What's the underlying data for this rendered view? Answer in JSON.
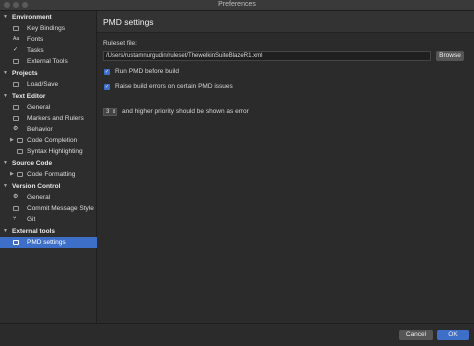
{
  "window": {
    "title": "Preferences"
  },
  "sidebar": {
    "sections": [
      {
        "label": "Environment",
        "items": [
          "Key Bindings",
          "Fonts",
          "Tasks",
          "External Tools"
        ]
      },
      {
        "label": "Projects",
        "items": [
          "Load/Save"
        ]
      },
      {
        "label": "Text Editor",
        "items": [
          "General",
          "Markers and Rulers",
          "Behavior",
          "Code Completion",
          "Syntax Highlighting"
        ]
      },
      {
        "label": "Source Code",
        "items": [
          "Code Formatting"
        ]
      },
      {
        "label": "Version Control",
        "items": [
          "General",
          "Commit Message Style",
          "Git"
        ]
      },
      {
        "label": "External tools",
        "items": [
          "PMD settings"
        ]
      }
    ]
  },
  "main": {
    "title": "PMD settings",
    "ruleset_label": "Ruleset file:",
    "ruleset_value": "/Users/rustamnurgudin/ruleset/ThewelkinSuiteBlazeR1.xml",
    "browse_label": "Browse",
    "run_pmd_label": "Run PMD before build",
    "raise_errors_label": "Raise build errors on certain PMD issues",
    "priority_value": "3",
    "priority_label": "and higher priority should be shown as error"
  },
  "footer": {
    "cancel_label": "Cancel",
    "ok_label": "OK"
  },
  "colors": {
    "accent": "#3d6fc9",
    "background": "#2b2b2b"
  }
}
